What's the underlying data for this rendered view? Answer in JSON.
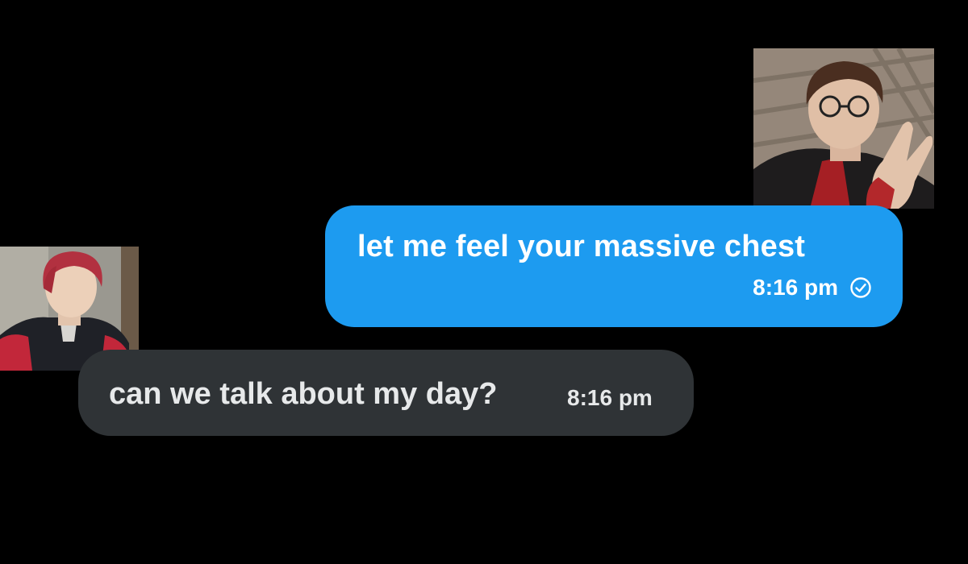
{
  "conversation": {
    "messages": [
      {
        "direction": "sent",
        "text": "let me feel your massive chest",
        "time": "8:16 pm",
        "status_icon": "read-check-icon"
      },
      {
        "direction": "received",
        "text": "can we talk about my day?",
        "time": "8:16 pm"
      }
    ]
  },
  "colors": {
    "background": "#000000",
    "sent_bubble": "#1d9bf0",
    "received_bubble": "#2f3336",
    "sent_text": "#ffffff",
    "received_text": "#e7e9ea"
  },
  "avatars": {
    "sender_photo": "sender-avatar-photo",
    "receiver_photo": "receiver-avatar-photo"
  }
}
